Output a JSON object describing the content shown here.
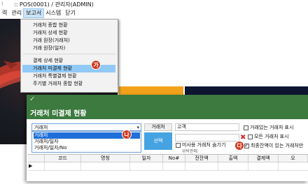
{
  "window": {
    "title": ":: POS(0001) / 관리자(ADMIN)"
  },
  "menubar": {
    "items": [
      "력",
      "관리",
      "보고서",
      "시스템",
      "닫기"
    ],
    "active_index": 2
  },
  "report_menu": {
    "group1": [
      "거래처 종합 현황",
      "거래처 상세 현황",
      "거래 원장(거래처)",
      "거래 원장(일자)"
    ],
    "group2": [
      "결제 상세 현황",
      "거래처 미결제 현황",
      "거래처 특별결제 현황",
      "주기별 거래처 종합 현황"
    ],
    "highlighted": "거래처 미결제 현황"
  },
  "markers": {
    "ga": "가",
    "na": "나",
    "da": "다"
  },
  "dialog": {
    "title": "거래처 미결제 현황",
    "search_type": {
      "value": "거래처",
      "options": [
        "거래처",
        "거래처/일자",
        "거래처/일자/No"
      ],
      "selected_index": 0
    },
    "label_partner": "거래처",
    "partner_input_value": "고객",
    "select_button": "선택",
    "checkboxes": [
      {
        "label": "거래있는 거래처 표시",
        "checked": false
      },
      {
        "label": "모든 거래처 표시",
        "checked": false
      },
      {
        "label": "최종잔액이 있는 거래처만",
        "checked": true
      },
      {
        "label": "미사용 거래처 숨기기",
        "checked": false
      }
    ],
    "sub_label": "위탁판매",
    "grid_columns": [
      "코드",
      "명칭",
      "일자",
      "No#",
      "전잔액",
      "출액",
      "결제액",
      "오"
    ]
  },
  "colors": {
    "dialog_header": "#3c7a3f",
    "menu_highlight": "#91c9f7",
    "select_button": "#46a3e2",
    "marker": "#d2391e",
    "orange_strip": "#f2a21a"
  }
}
